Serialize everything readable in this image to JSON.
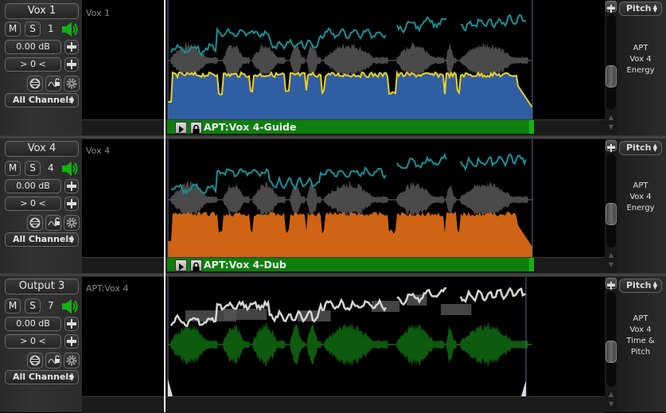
{
  "tracks": [
    {
      "name": "Vox 1",
      "mute_label": "M",
      "solo_label": "S",
      "number": "1",
      "gain": "0.00 dB",
      "pan": "> 0 <",
      "channels": "All Channels",
      "track_label": "Vox 1",
      "clip_label": "APT:Vox 4-Guide",
      "view_mode": "Pitch",
      "description": [
        "APT",
        "Vox 4",
        "Energy"
      ],
      "fill_color": "#2f5ea3",
      "outline_color": "#e8d22a",
      "pitch_color": "#1a8f96",
      "wave_color": "#4a4a4a",
      "scroll_position": 0.55
    },
    {
      "name": "Vox 4",
      "mute_label": "M",
      "solo_label": "S",
      "number": "4",
      "gain": "0.00 dB",
      "pan": "> 0 <",
      "channels": "All Channels",
      "track_label": "Vox 4",
      "clip_label": "APT:Vox 4-Dub",
      "view_mode": "Pitch",
      "description": [
        "APT",
        "Vox 4",
        "Energy"
      ],
      "fill_color": "#cf6414",
      "pitch_color": "#1a8f96",
      "wave_color": "#4a4a4a",
      "scroll_position": 0.55
    },
    {
      "name": "Output 3",
      "mute_label": "M",
      "solo_label": "S",
      "number": "7",
      "gain": "0.00 dB",
      "pan": "> 0 <",
      "channels": "All Channels",
      "track_label": "APT:Vox 4",
      "view_mode": "Pitch",
      "description": [
        "APT",
        "Vox 4",
        "Time &",
        "Pitch"
      ],
      "wave_color": "#0e5a0e",
      "pitch_color": "#d6d6d6",
      "scroll_position": 0.55
    }
  ],
  "colors": {
    "clip_bar": "#0e7f0e",
    "speaker": "#12b012"
  }
}
